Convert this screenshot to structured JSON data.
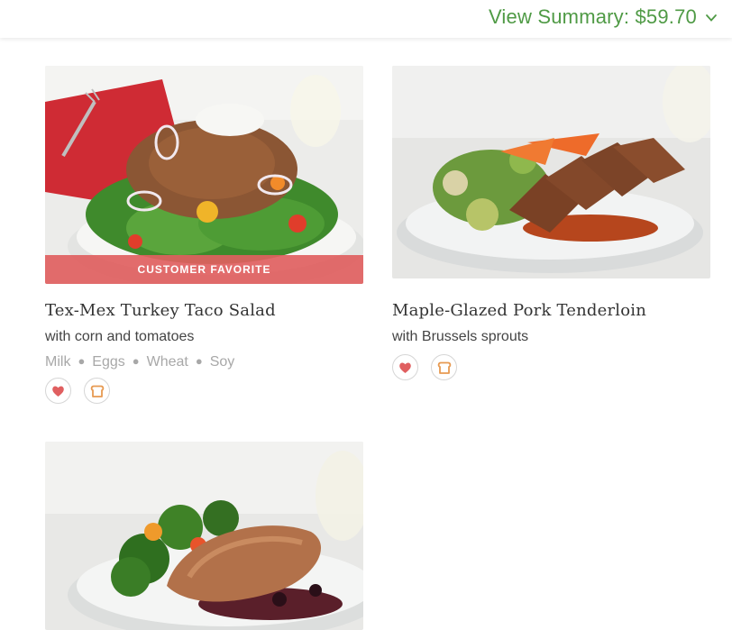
{
  "header": {
    "summary_label": "View Summary: $59.70"
  },
  "meals": [
    {
      "title": "Tex-Mex Turkey Taco Salad",
      "subtitle": "with corn and tomatoes",
      "badge": "CUSTOMER FAVORITE",
      "allergens": [
        "Milk",
        "Eggs",
        "Wheat",
        "Soy"
      ],
      "icons": [
        "heart-icon",
        "bread-icon"
      ]
    },
    {
      "title": "Maple-Glazed Pork Tenderloin",
      "subtitle": "with Brussels sprouts",
      "allergens": [],
      "icons": [
        "heart-icon",
        "bread-icon"
      ]
    },
    {
      "title": "",
      "subtitle": "",
      "allergens": [],
      "icons": []
    }
  ],
  "colors": {
    "accent_green": "#4f9a45",
    "badge_red": "#e05f60",
    "heart": "#e05f60",
    "bread": "#e79a52"
  }
}
